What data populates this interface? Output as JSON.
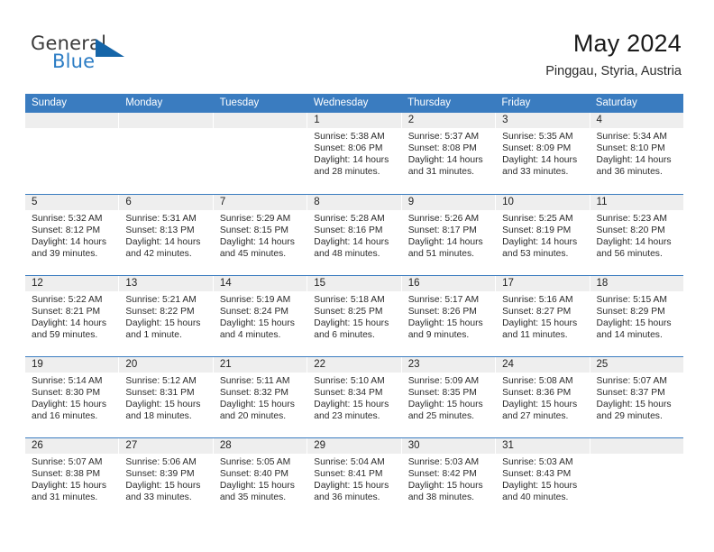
{
  "brand": {
    "name_top": "General",
    "name_bottom": "Blue",
    "triangle_icon": "triangle-icon",
    "color_top": "#3b3b3b",
    "color_bottom": "#2b7cc4",
    "color_triangle": "#1565a8"
  },
  "header": {
    "title": "May 2024",
    "subtitle": "Pinggau, Styria, Austria"
  },
  "theme": {
    "header_blue": "#3a7cc0",
    "row_divider": "#3a7cc0",
    "daynum_band": "#eeeeee",
    "text": "#2b2b2b"
  },
  "calendar": {
    "weekdays": [
      "Sunday",
      "Monday",
      "Tuesday",
      "Wednesday",
      "Thursday",
      "Friday",
      "Saturday"
    ],
    "weeks": [
      [
        {
          "day": "",
          "lines": []
        },
        {
          "day": "",
          "lines": []
        },
        {
          "day": "",
          "lines": []
        },
        {
          "day": "1",
          "lines": [
            "Sunrise: 5:38 AM",
            "Sunset: 8:06 PM",
            "Daylight: 14 hours",
            "and 28 minutes."
          ]
        },
        {
          "day": "2",
          "lines": [
            "Sunrise: 5:37 AM",
            "Sunset: 8:08 PM",
            "Daylight: 14 hours",
            "and 31 minutes."
          ]
        },
        {
          "day": "3",
          "lines": [
            "Sunrise: 5:35 AM",
            "Sunset: 8:09 PM",
            "Daylight: 14 hours",
            "and 33 minutes."
          ]
        },
        {
          "day": "4",
          "lines": [
            "Sunrise: 5:34 AM",
            "Sunset: 8:10 PM",
            "Daylight: 14 hours",
            "and 36 minutes."
          ]
        }
      ],
      [
        {
          "day": "5",
          "lines": [
            "Sunrise: 5:32 AM",
            "Sunset: 8:12 PM",
            "Daylight: 14 hours",
            "and 39 minutes."
          ]
        },
        {
          "day": "6",
          "lines": [
            "Sunrise: 5:31 AM",
            "Sunset: 8:13 PM",
            "Daylight: 14 hours",
            "and 42 minutes."
          ]
        },
        {
          "day": "7",
          "lines": [
            "Sunrise: 5:29 AM",
            "Sunset: 8:15 PM",
            "Daylight: 14 hours",
            "and 45 minutes."
          ]
        },
        {
          "day": "8",
          "lines": [
            "Sunrise: 5:28 AM",
            "Sunset: 8:16 PM",
            "Daylight: 14 hours",
            "and 48 minutes."
          ]
        },
        {
          "day": "9",
          "lines": [
            "Sunrise: 5:26 AM",
            "Sunset: 8:17 PM",
            "Daylight: 14 hours",
            "and 51 minutes."
          ]
        },
        {
          "day": "10",
          "lines": [
            "Sunrise: 5:25 AM",
            "Sunset: 8:19 PM",
            "Daylight: 14 hours",
            "and 53 minutes."
          ]
        },
        {
          "day": "11",
          "lines": [
            "Sunrise: 5:23 AM",
            "Sunset: 8:20 PM",
            "Daylight: 14 hours",
            "and 56 minutes."
          ]
        }
      ],
      [
        {
          "day": "12",
          "lines": [
            "Sunrise: 5:22 AM",
            "Sunset: 8:21 PM",
            "Daylight: 14 hours",
            "and 59 minutes."
          ]
        },
        {
          "day": "13",
          "lines": [
            "Sunrise: 5:21 AM",
            "Sunset: 8:22 PM",
            "Daylight: 15 hours",
            "and 1 minute."
          ]
        },
        {
          "day": "14",
          "lines": [
            "Sunrise: 5:19 AM",
            "Sunset: 8:24 PM",
            "Daylight: 15 hours",
            "and 4 minutes."
          ]
        },
        {
          "day": "15",
          "lines": [
            "Sunrise: 5:18 AM",
            "Sunset: 8:25 PM",
            "Daylight: 15 hours",
            "and 6 minutes."
          ]
        },
        {
          "day": "16",
          "lines": [
            "Sunrise: 5:17 AM",
            "Sunset: 8:26 PM",
            "Daylight: 15 hours",
            "and 9 minutes."
          ]
        },
        {
          "day": "17",
          "lines": [
            "Sunrise: 5:16 AM",
            "Sunset: 8:27 PM",
            "Daylight: 15 hours",
            "and 11 minutes."
          ]
        },
        {
          "day": "18",
          "lines": [
            "Sunrise: 5:15 AM",
            "Sunset: 8:29 PM",
            "Daylight: 15 hours",
            "and 14 minutes."
          ]
        }
      ],
      [
        {
          "day": "19",
          "lines": [
            "Sunrise: 5:14 AM",
            "Sunset: 8:30 PM",
            "Daylight: 15 hours",
            "and 16 minutes."
          ]
        },
        {
          "day": "20",
          "lines": [
            "Sunrise: 5:12 AM",
            "Sunset: 8:31 PM",
            "Daylight: 15 hours",
            "and 18 minutes."
          ]
        },
        {
          "day": "21",
          "lines": [
            "Sunrise: 5:11 AM",
            "Sunset: 8:32 PM",
            "Daylight: 15 hours",
            "and 20 minutes."
          ]
        },
        {
          "day": "22",
          "lines": [
            "Sunrise: 5:10 AM",
            "Sunset: 8:34 PM",
            "Daylight: 15 hours",
            "and 23 minutes."
          ]
        },
        {
          "day": "23",
          "lines": [
            "Sunrise: 5:09 AM",
            "Sunset: 8:35 PM",
            "Daylight: 15 hours",
            "and 25 minutes."
          ]
        },
        {
          "day": "24",
          "lines": [
            "Sunrise: 5:08 AM",
            "Sunset: 8:36 PM",
            "Daylight: 15 hours",
            "and 27 minutes."
          ]
        },
        {
          "day": "25",
          "lines": [
            "Sunrise: 5:07 AM",
            "Sunset: 8:37 PM",
            "Daylight: 15 hours",
            "and 29 minutes."
          ]
        }
      ],
      [
        {
          "day": "26",
          "lines": [
            "Sunrise: 5:07 AM",
            "Sunset: 8:38 PM",
            "Daylight: 15 hours",
            "and 31 minutes."
          ]
        },
        {
          "day": "27",
          "lines": [
            "Sunrise: 5:06 AM",
            "Sunset: 8:39 PM",
            "Daylight: 15 hours",
            "and 33 minutes."
          ]
        },
        {
          "day": "28",
          "lines": [
            "Sunrise: 5:05 AM",
            "Sunset: 8:40 PM",
            "Daylight: 15 hours",
            "and 35 minutes."
          ]
        },
        {
          "day": "29",
          "lines": [
            "Sunrise: 5:04 AM",
            "Sunset: 8:41 PM",
            "Daylight: 15 hours",
            "and 36 minutes."
          ]
        },
        {
          "day": "30",
          "lines": [
            "Sunrise: 5:03 AM",
            "Sunset: 8:42 PM",
            "Daylight: 15 hours",
            "and 38 minutes."
          ]
        },
        {
          "day": "31",
          "lines": [
            "Sunrise: 5:03 AM",
            "Sunset: 8:43 PM",
            "Daylight: 15 hours",
            "and 40 minutes."
          ]
        },
        {
          "day": "",
          "lines": []
        }
      ]
    ]
  }
}
